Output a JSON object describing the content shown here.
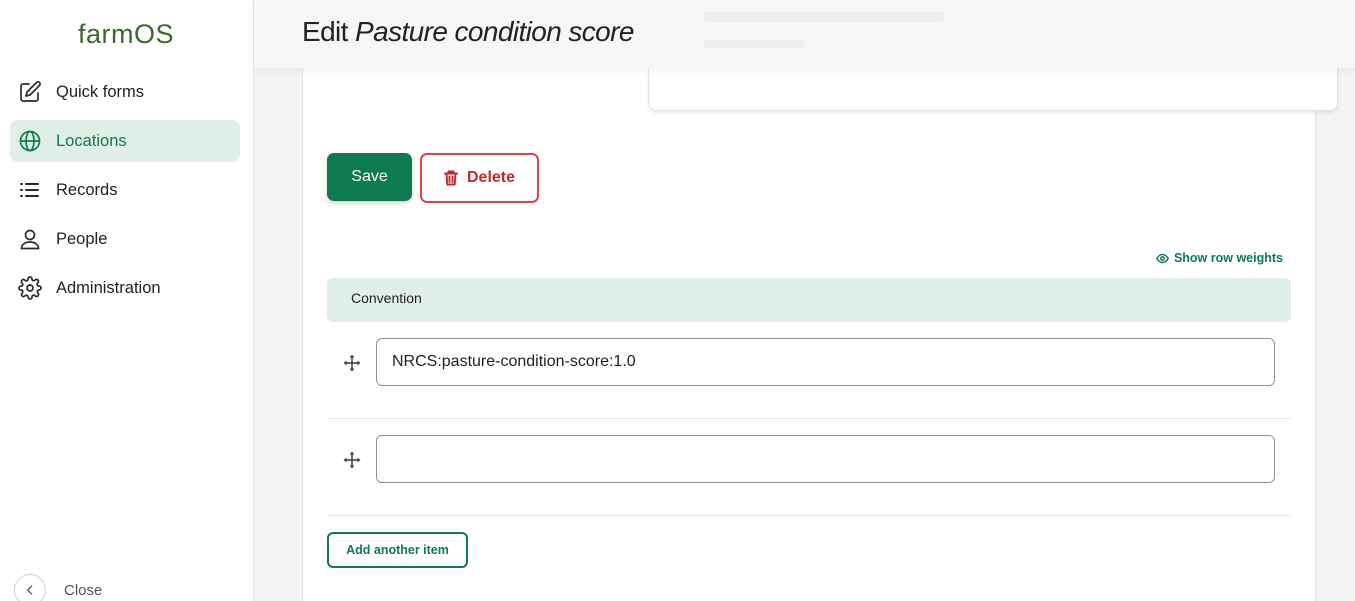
{
  "app": {
    "brand": "farmOS",
    "page_title_prefix": "Edit",
    "page_title_entity": "Pasture condition score"
  },
  "sidebar": {
    "items": [
      {
        "label": "Quick forms",
        "icon": "edit-icon",
        "active": false
      },
      {
        "label": "Locations",
        "icon": "globe-icon",
        "active": true
      },
      {
        "label": "Records",
        "icon": "list-icon",
        "active": false
      },
      {
        "label": "People",
        "icon": "person-icon",
        "active": false
      },
      {
        "label": "Administration",
        "icon": "gear-icon",
        "active": false
      }
    ],
    "close_label": "Close"
  },
  "actions": {
    "save_label": "Save",
    "delete_label": "Delete"
  },
  "convention_table": {
    "show_weights_label": "Show row weights",
    "header": "Convention",
    "rows": [
      {
        "value": "NRCS:pasture-condition-score:1.0"
      },
      {
        "value": ""
      }
    ],
    "add_label": "Add another item"
  },
  "colors": {
    "accent": "#0e7a50",
    "accent_bg": "#e0efe7",
    "danger": "#c62828",
    "brand": "#3a6b2a"
  }
}
